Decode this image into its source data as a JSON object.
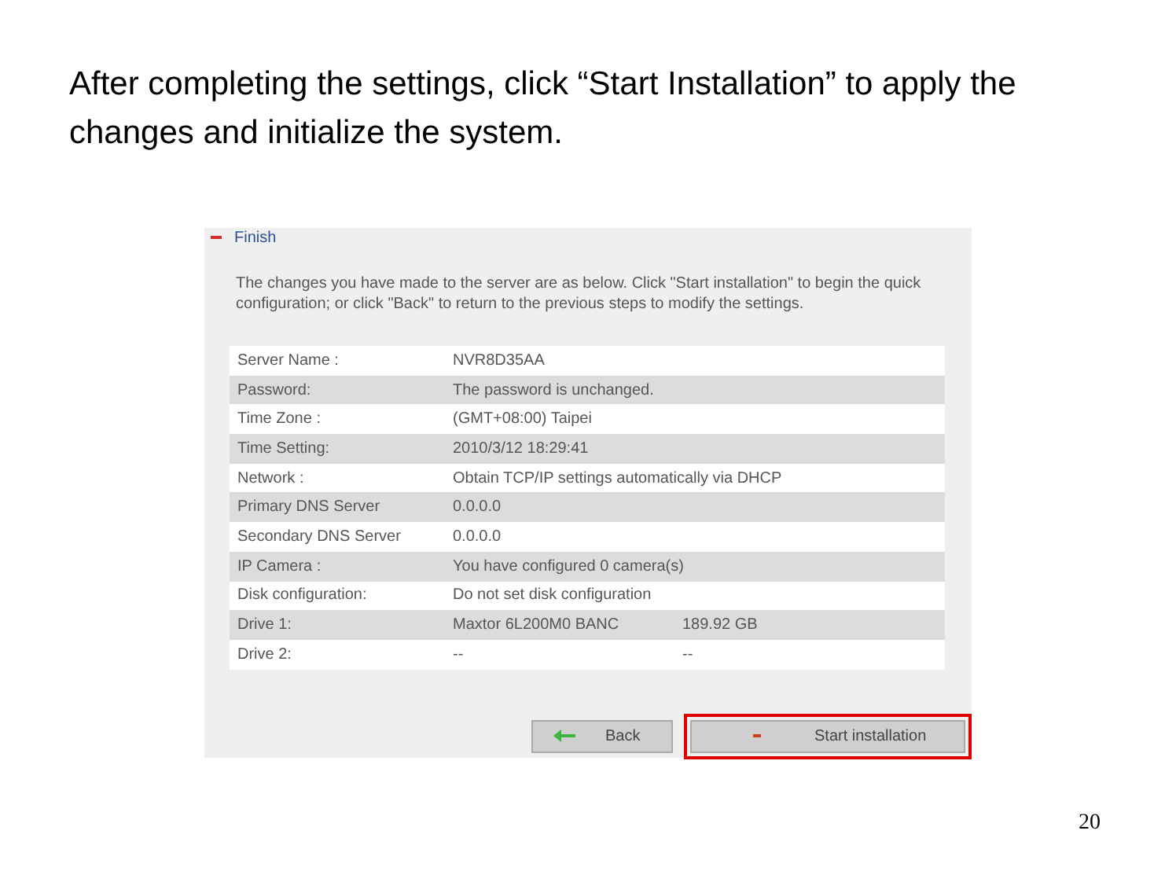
{
  "slide": {
    "instruction": "After completing the settings, click “Start Installation” to apply the changes and initialize the system.",
    "page_number": "20"
  },
  "panel": {
    "title": "Finish",
    "expanded": true,
    "description": "The changes you have made to the server are as below. Click \"Start installation\" to begin the quick configuration; or click \"Back\" to return to the previous steps to modify the settings.",
    "rows": [
      {
        "label": "Server Name :",
        "value": "NVR8D35AA"
      },
      {
        "label": "Password:",
        "value": "The password is unchanged."
      },
      {
        "label": "Time Zone :",
        "value": "(GMT+08:00) Taipei"
      },
      {
        "label": "Time Setting:",
        "value": "2010/3/12 18:29:41"
      },
      {
        "label": "Network :",
        "value": "Obtain TCP/IP settings automatically via DHCP"
      },
      {
        "label": "Primary DNS Server",
        "value": "0.0.0.0"
      },
      {
        "label": "Secondary DNS Server",
        "value": "0.0.0.0"
      },
      {
        "label": "IP Camera :",
        "value": "You have configured 0 camera(s)"
      },
      {
        "label": "Disk configuration:",
        "value": "Do not set disk configuration"
      },
      {
        "label": "Drive 1:",
        "value": "Maxtor 6L200M0 BANC",
        "extra": "189.92 GB"
      },
      {
        "label": "Drive 2:",
        "value": "--",
        "extra": "--"
      }
    ],
    "back_button": "Back",
    "start_button": {
      "label": "Start installation",
      "highlighted": true
    }
  }
}
